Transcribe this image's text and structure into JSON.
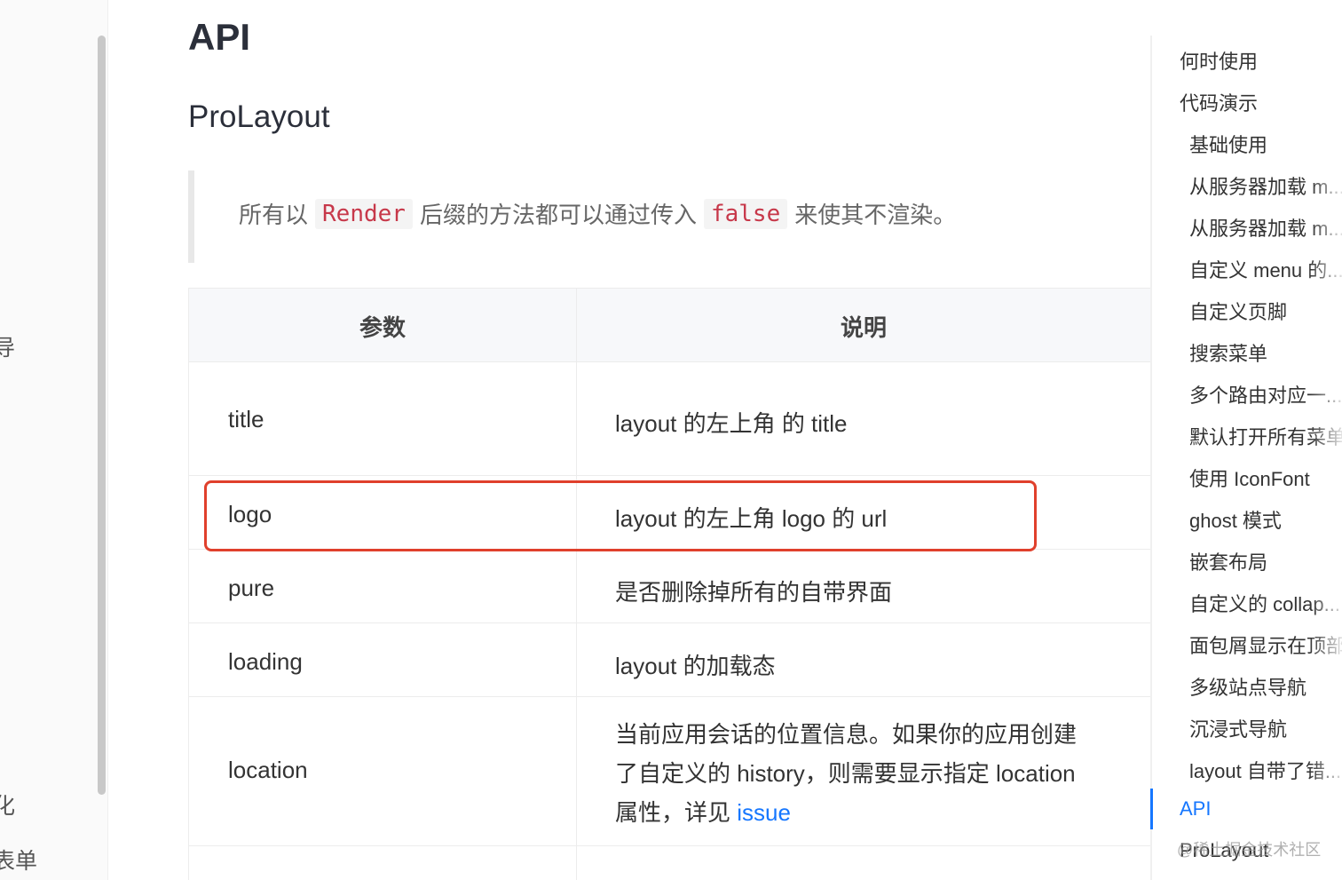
{
  "left_sidebar": {
    "items": [
      "导",
      "化",
      "表单"
    ]
  },
  "main": {
    "title": "API",
    "subtitle": "ProLayout",
    "note": {
      "prefix": "所有以",
      "code1": "Render",
      "middle": "后缀的方法都可以通过传入",
      "code2": "false",
      "suffix": "来使其不渲染。"
    },
    "table": {
      "headers": [
        "参数",
        "说明"
      ],
      "rows": [
        {
          "param": "title",
          "desc": "layout 的左上角 的 title"
        },
        {
          "param": "logo",
          "desc": "layout 的左上角 logo 的 url"
        },
        {
          "param": "pure",
          "desc": "是否删除掉所有的自带界面"
        },
        {
          "param": "loading",
          "desc": "layout 的加载态"
        },
        {
          "param": "location",
          "desc_line1": "当前应用会话的位置信息。如果你的应用创建",
          "desc_line2": "了自定义的 history，则需要显示指定 location",
          "desc_line3_prefix": "属性，详见 ",
          "desc_link": "issue"
        }
      ]
    }
  },
  "toc": {
    "items": [
      {
        "label": "何时使用",
        "level": 1
      },
      {
        "label": "代码演示",
        "level": 1
      },
      {
        "label": "基础使用",
        "level": 2
      },
      {
        "label": "从服务器加载 m...",
        "level": 2
      },
      {
        "label": "从服务器加载 m...",
        "level": 2
      },
      {
        "label": "自定义 menu 的...",
        "level": 2
      },
      {
        "label": "自定义页脚",
        "level": 2
      },
      {
        "label": "搜索菜单",
        "level": 2
      },
      {
        "label": "多个路由对应一...",
        "level": 2
      },
      {
        "label": "默认打开所有菜单",
        "level": 2
      },
      {
        "label": "使用 IconFont",
        "level": 2
      },
      {
        "label": "ghost 模式",
        "level": 2
      },
      {
        "label": "嵌套布局",
        "level": 2
      },
      {
        "label": "自定义的 collap...",
        "level": 2
      },
      {
        "label": "面包屑显示在顶部",
        "level": 2
      },
      {
        "label": "多级站点导航",
        "level": 2
      },
      {
        "label": "沉浸式导航",
        "level": 2
      },
      {
        "label": "layout 自带了错...",
        "level": 2
      },
      {
        "label": "API",
        "level": 1,
        "active": true
      },
      {
        "label": "ProLayout",
        "level": 1
      }
    ]
  },
  "watermark": "@稀土掘金技术社区",
  "colors": {
    "accent": "#1677ff",
    "highlight": "#e0402c",
    "code": "#c7384a"
  }
}
